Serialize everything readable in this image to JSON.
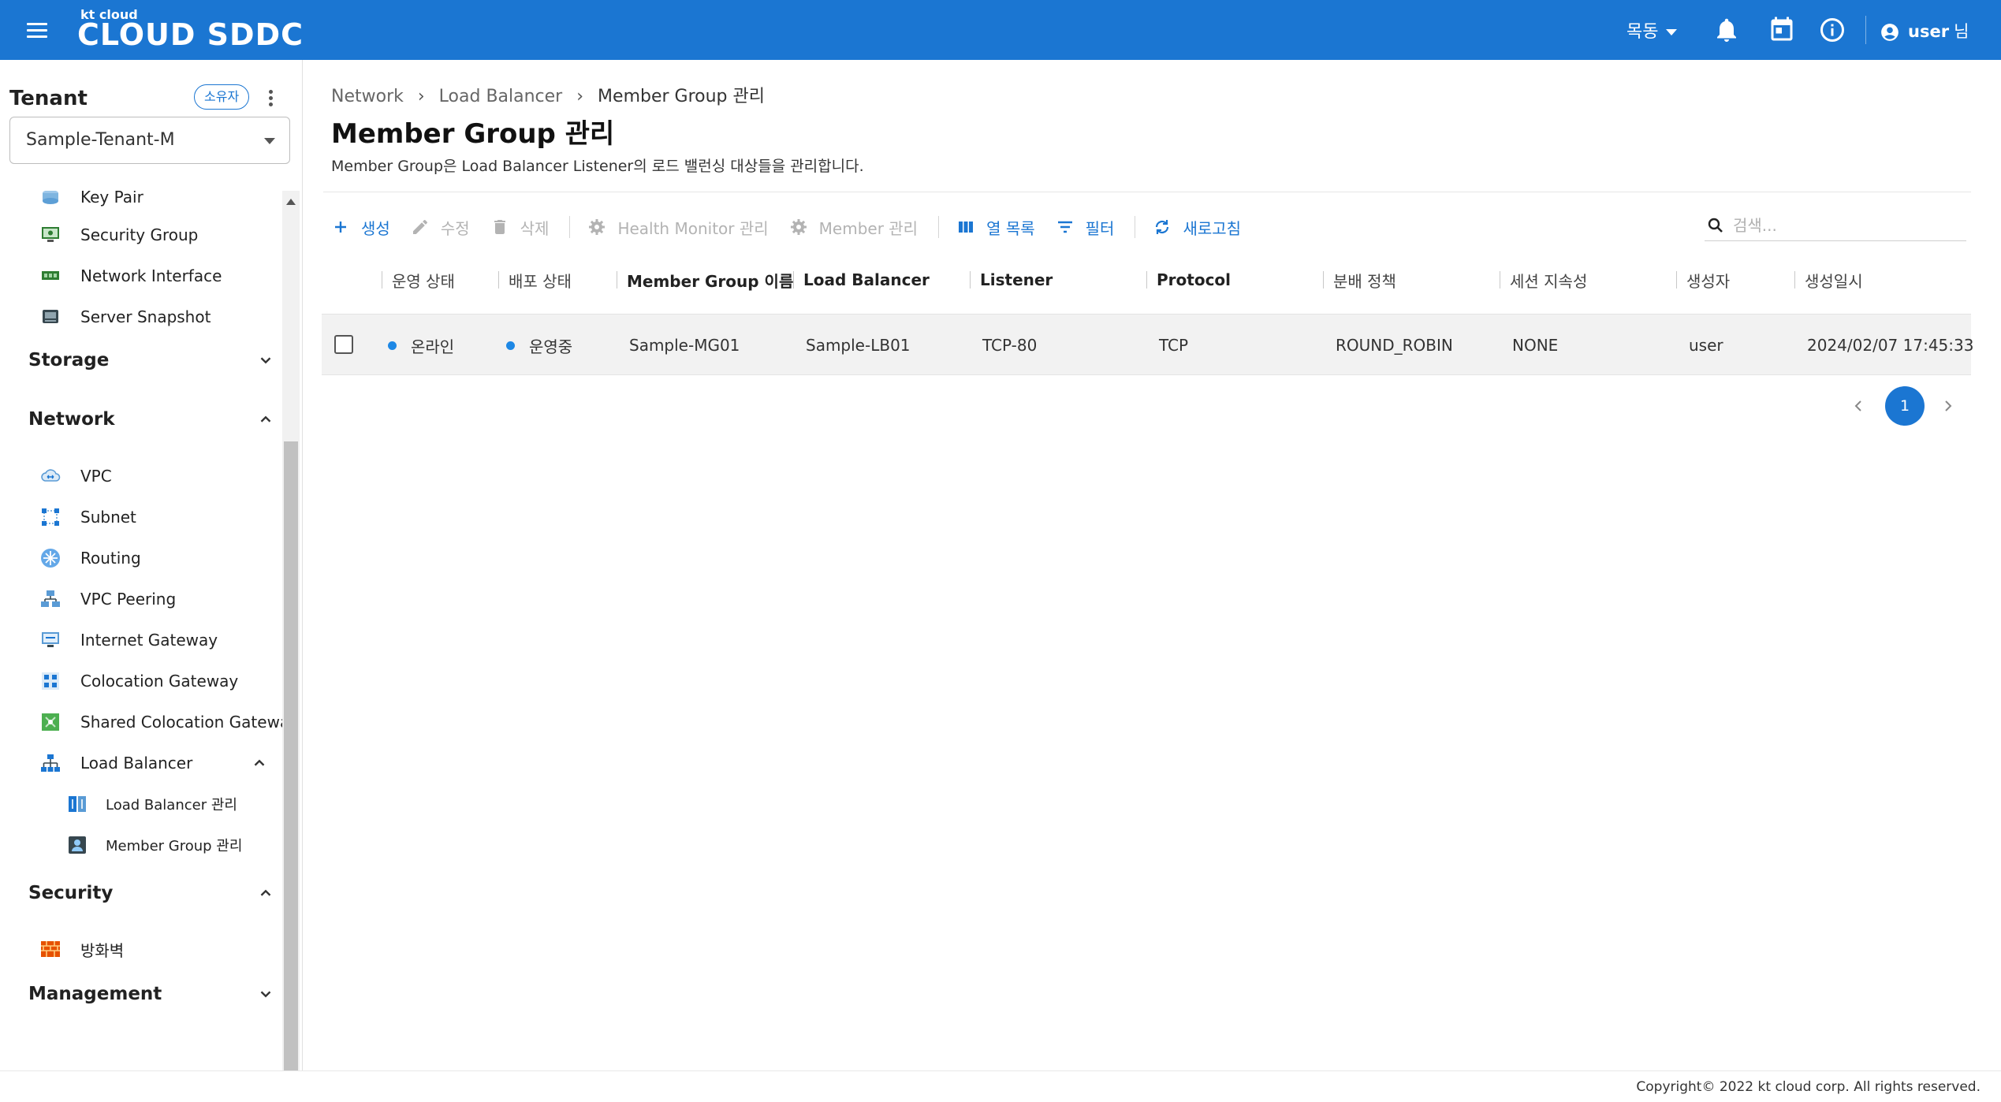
{
  "header": {
    "logo_small": "kt cloud",
    "logo_big": "CLOUD SDDC",
    "region": "목동",
    "user_name": "user",
    "user_suffix": "님"
  },
  "sidebar": {
    "tenant_title": "Tenant",
    "owner_badge": "소유자",
    "tenant_selected": "Sample-Tenant-M",
    "items_top": [
      {
        "label": "Key Pair",
        "icon": "key-pair-icon"
      },
      {
        "label": "Security Group",
        "icon": "security-group-icon"
      },
      {
        "label": "Network Interface",
        "icon": "network-interface-icon"
      },
      {
        "label": "Server Snapshot",
        "icon": "server-snapshot-icon"
      }
    ],
    "sections": {
      "storage": "Storage",
      "network": "Network",
      "security": "Security",
      "management": "Management"
    },
    "network_items": [
      {
        "label": "VPC",
        "icon": "vpc-icon"
      },
      {
        "label": "Subnet",
        "icon": "subnet-icon"
      },
      {
        "label": "Routing",
        "icon": "routing-icon"
      },
      {
        "label": "VPC Peering",
        "icon": "vpc-peering-icon"
      },
      {
        "label": "Internet Gateway",
        "icon": "internet-gateway-icon"
      },
      {
        "label": "Colocation Gateway",
        "icon": "colocation-gateway-icon"
      },
      {
        "label": "Shared Colocation Gateway",
        "icon": "shared-colocation-gateway-icon"
      },
      {
        "label": "Load Balancer",
        "icon": "load-balancer-icon"
      }
    ],
    "lb_sub_items": [
      {
        "label": "Load Balancer 관리",
        "icon": "load-balancer-manage-icon"
      },
      {
        "label": "Member Group 관리",
        "icon": "member-group-icon"
      }
    ],
    "security_items": [
      {
        "label": "방화벽",
        "icon": "firewall-icon"
      }
    ]
  },
  "breadcrumb": [
    "Network",
    "Load Balancer",
    "Member Group 관리"
  ],
  "page": {
    "title": "Member Group 관리",
    "description": "Member Group은 Load Balancer Listener의 로드 밸런싱 대상들을 관리합니다."
  },
  "toolbar": {
    "create": "생성",
    "edit": "수정",
    "delete": "삭제",
    "health_monitor": "Health Monitor 관리",
    "member": "Member 관리",
    "columns": "열 목록",
    "filter": "필터",
    "refresh": "새로고침",
    "search_placeholder": "검색..."
  },
  "table": {
    "columns": [
      "운영 상태",
      "배포 상태",
      "Member Group 이름",
      "Load Balancer",
      "Listener",
      "Protocol",
      "분배 정책",
      "세션 지속성",
      "생성자",
      "생성일시"
    ],
    "rows": [
      [
        "온라인",
        "운영중",
        "Sample-MG01",
        "Sample-LB01",
        "TCP-80",
        "TCP",
        "ROUND_ROBIN",
        "NONE",
        "user",
        "2024/02/07 17:45:33"
      ]
    ]
  },
  "pagination": {
    "current": "1"
  },
  "footer": {
    "copyright": "Copyright© 2022 kt cloud corp. All rights reserved."
  },
  "colors": {
    "primary": "#1b76d2",
    "status_dot": "#1e88e5"
  }
}
